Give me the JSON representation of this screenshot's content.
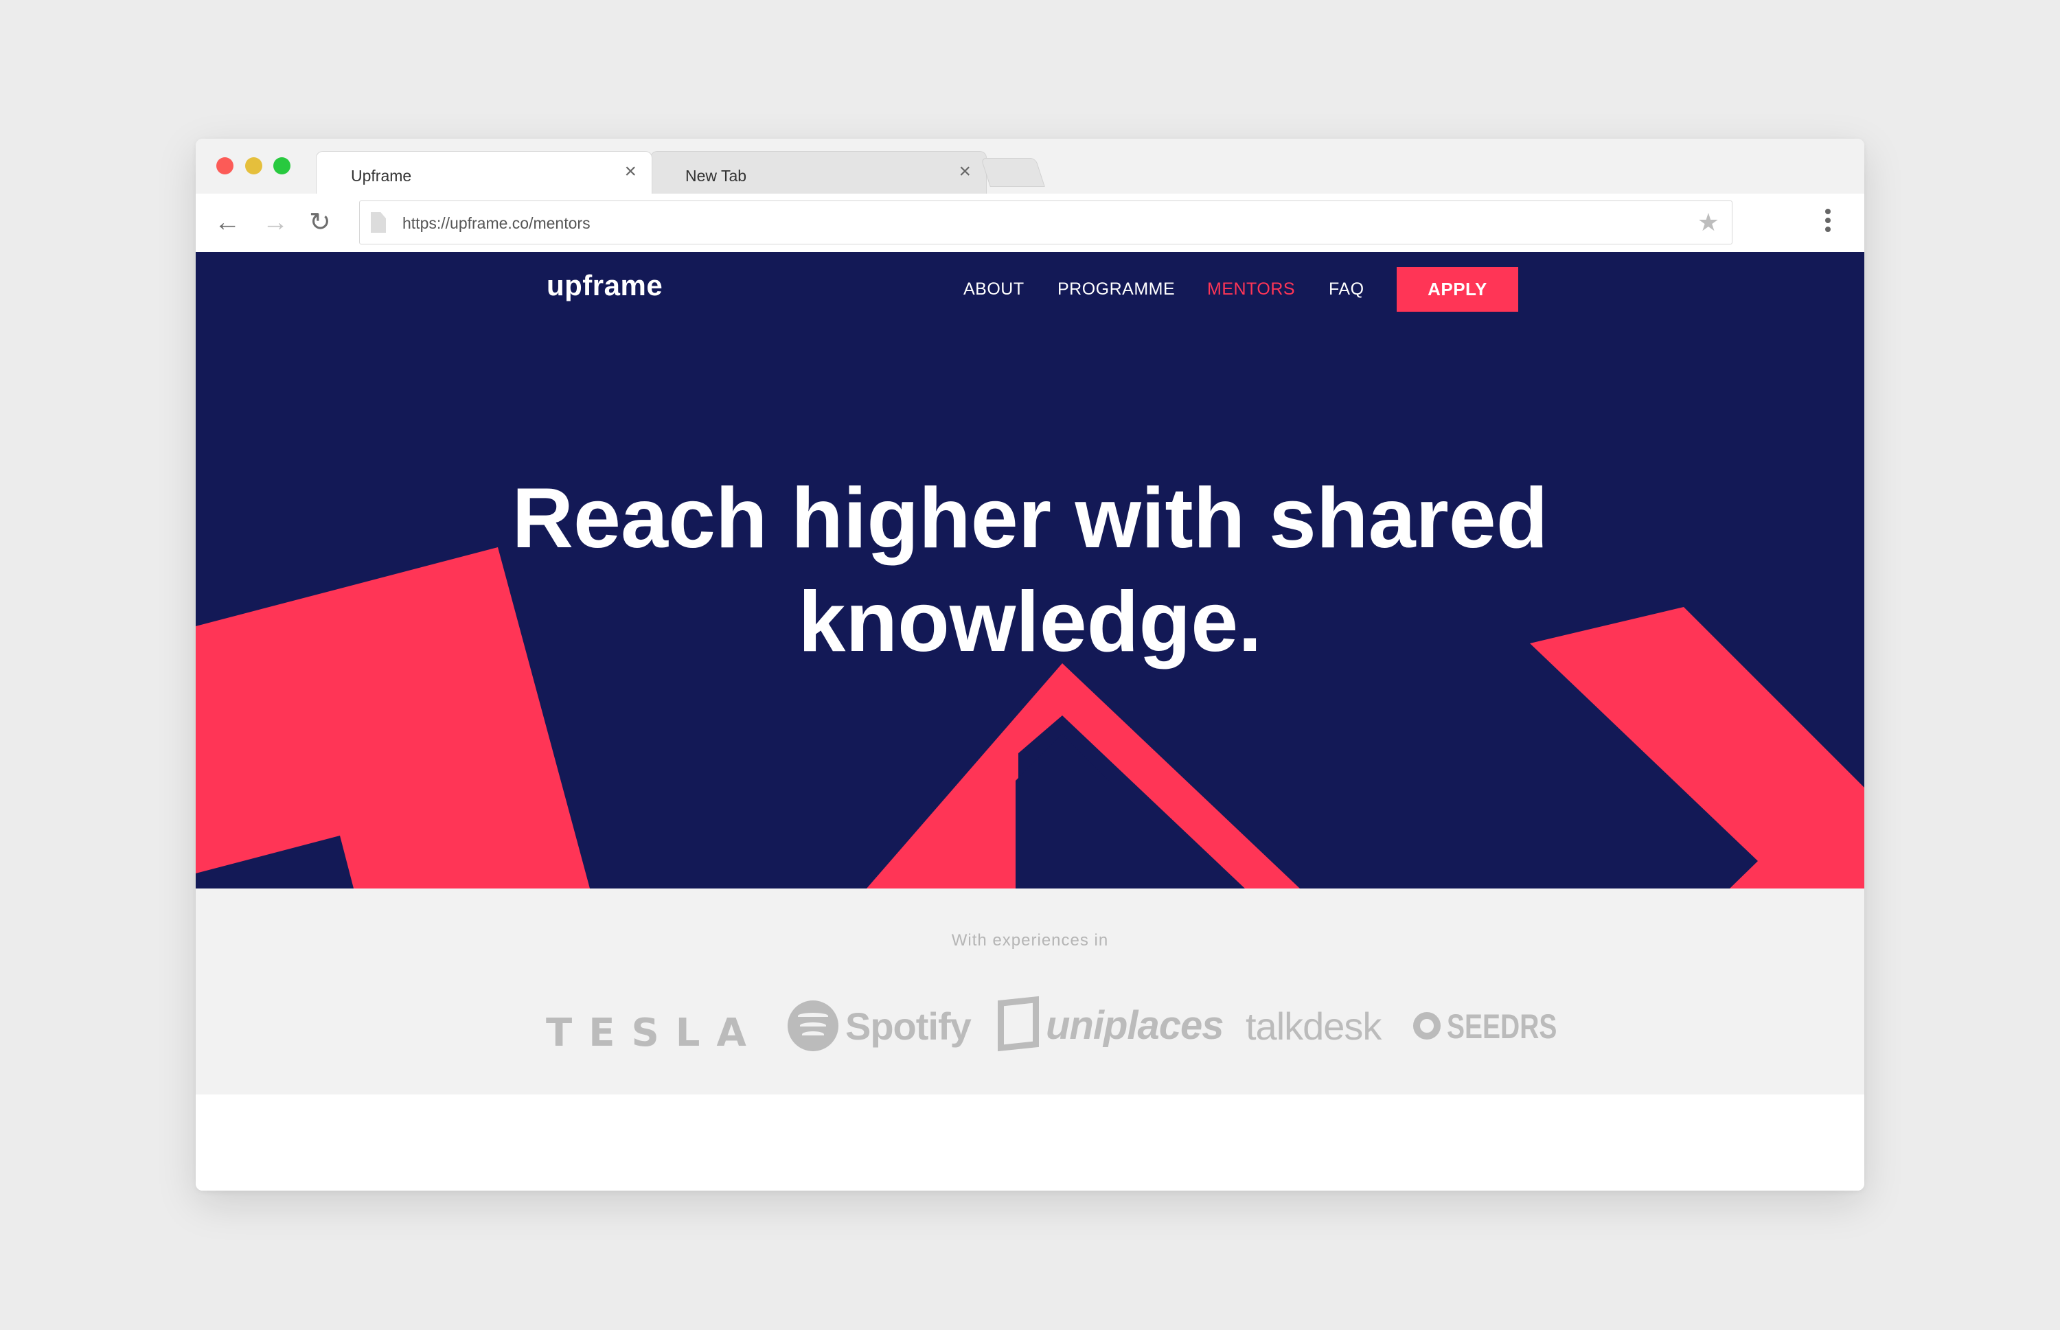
{
  "browser": {
    "tabs": [
      {
        "title": "Upframe",
        "close": "×"
      },
      {
        "title": "New Tab",
        "close": "×"
      }
    ],
    "address_bar": {
      "url": "https://upframe.co/mentors"
    },
    "icons": [
      "back-arrow-icon",
      "forward-arrow-icon",
      "reload-icon",
      "page-icon",
      "star-icon",
      "menu-dots-icon"
    ]
  },
  "site": {
    "logo": "upframe",
    "nav": {
      "about": "ABOUT",
      "programme": "PROGRAMME",
      "mentors": "MENTORS",
      "faq": "FAQ",
      "apply": "APPLY"
    },
    "headline": {
      "line1": "Reach higher with shared",
      "line2": "knowledge."
    },
    "experience": {
      "label": "With experiences in",
      "brands": {
        "tesla": "TESLA",
        "spotify": "Spotify",
        "uniplaces": "uniplaces",
        "talkdesk": "talkdesk",
        "seedrs": "SEEDRS"
      }
    },
    "colors": {
      "navy": "#131956",
      "accent": "#ff3556",
      "logo_gray": "#bbbbbb",
      "band_gray": "#f2f2f2"
    }
  }
}
